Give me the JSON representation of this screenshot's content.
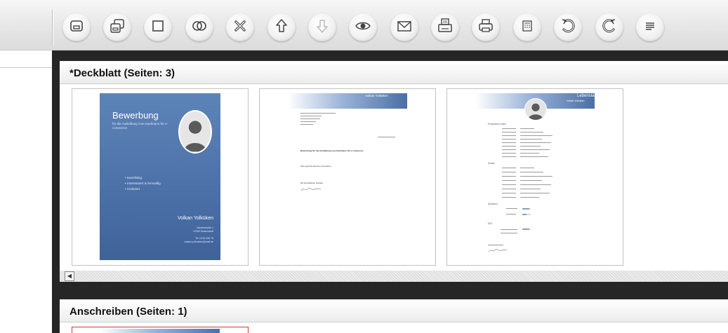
{
  "toolbar": {
    "buttons": [
      {
        "icon": "save-icon"
      },
      {
        "icon": "save-as-icon"
      },
      {
        "icon": "new-document-icon"
      },
      {
        "icon": "duplicate-icon"
      },
      {
        "icon": "delete-icon"
      },
      {
        "icon": "move-up-icon"
      },
      {
        "icon": "move-down-icon"
      },
      {
        "icon": "preview-icon"
      },
      {
        "icon": "email-icon"
      },
      {
        "icon": "fax-icon"
      },
      {
        "icon": "print-icon"
      },
      {
        "icon": "calculator-icon"
      },
      {
        "icon": "undo-icon"
      },
      {
        "icon": "redo-icon"
      },
      {
        "icon": "menu-icon"
      }
    ]
  },
  "sections": [
    {
      "title": "*Deckblatt (Seiten: 3)"
    },
    {
      "title": "Anschreiben (Seiten: 1)"
    }
  ],
  "cover": {
    "title": "Bewerbung",
    "subtitle": "für die Ausbildung zum Kaufmann für e-commerce",
    "bullets": [
      "• teamfähig",
      "• interessiert & lernwillig",
      "• motiviert"
    ],
    "name": "Volkan Yolküken",
    "address": "Musterstraße 1\n12345 Musterstadt\n\nTel. 0123 456 78\nvolkan.yolkueken@mail.de"
  },
  "letter": {
    "banner_name": "Volkan Yolküken",
    "subject": "Bewerbung für die Ausbildung zum Kaufmann für e-commerce",
    "greeting": "Sehr geehrte Damen und Herren,",
    "closing": "Mit freundlichen Grüßen"
  },
  "cv": {
    "title": "Lebenslauf",
    "name": "Volkan Yolküken",
    "section_personal": "Persönliche Daten",
    "section_school": "Schule",
    "section_languages": "Sprachen",
    "section_it": "EDV"
  },
  "colors": {
    "accent": "#4b70a8",
    "frame": "#262626",
    "selected_border": "#d23a3a"
  }
}
